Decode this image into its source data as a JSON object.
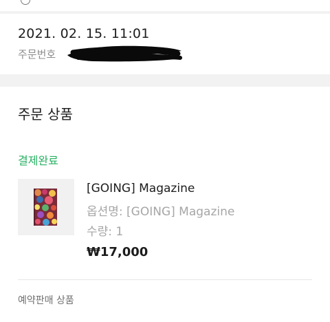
{
  "header": {
    "date": "2021. 02. 15. 11:01",
    "order_number_label": "주문번호"
  },
  "product_section": {
    "title": "주문 상품",
    "status": "결제완료",
    "status_color": "#27b062",
    "item": {
      "name": "[GOING] Magazine",
      "option": "옵션명: [GOING] Magazine",
      "quantity": "수량: 1",
      "price": "₩17,000"
    },
    "preorder_label": "예약판매 상품"
  }
}
